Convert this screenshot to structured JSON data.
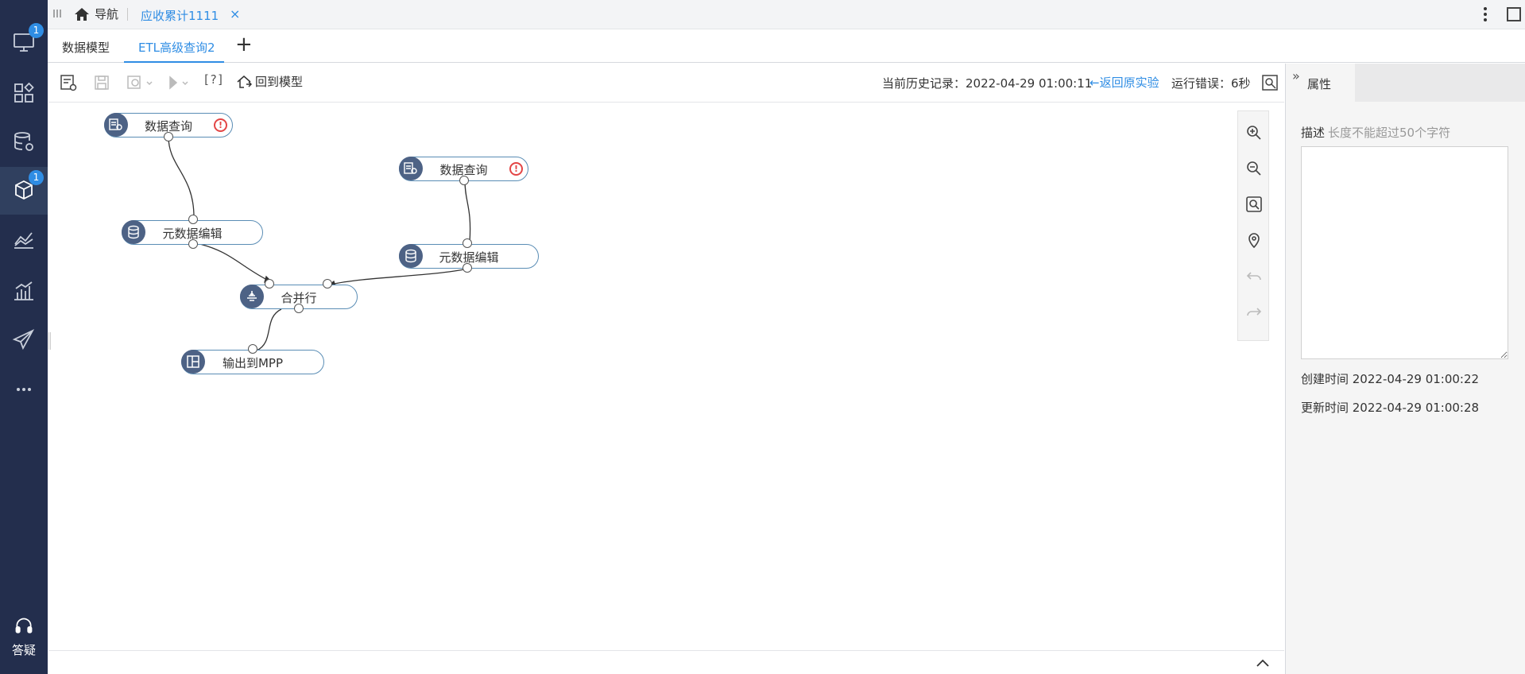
{
  "sidebar": {
    "items": [
      {
        "name": "monitor",
        "badge": "1"
      },
      {
        "name": "apps"
      },
      {
        "name": "database-settings"
      },
      {
        "name": "model-cube",
        "badge": "1"
      },
      {
        "name": "chart-line"
      },
      {
        "name": "chart-bar"
      },
      {
        "name": "send"
      },
      {
        "name": "more"
      }
    ],
    "help_label": "答疑"
  },
  "topbar": {
    "home_label": "导航",
    "doc_tab": "应收累计1111",
    "close_glyph": "×"
  },
  "subtabs": {
    "items": [
      "数据模型",
      "ETL高级查询2"
    ],
    "active": "ETL高级查询2",
    "add_glyph": "+"
  },
  "toolbar": {
    "help_label": "[?]",
    "back_label": "回到模型",
    "history_label": "当前历史记录：2022-04-29 01:00:11",
    "restore_label": "←返回原实验",
    "error_label": "运行错误：6秒"
  },
  "flow": {
    "nodes": [
      {
        "id": "q1",
        "label": "数据查询",
        "warning": true
      },
      {
        "id": "q2",
        "label": "数据查询",
        "warning": true
      },
      {
        "id": "m1",
        "label": "元数据编辑",
        "warning": false
      },
      {
        "id": "m2",
        "label": "元数据编辑",
        "warning": false
      },
      {
        "id": "merge",
        "label": "合并行",
        "warning": false
      },
      {
        "id": "out",
        "label": "输出到MPP",
        "warning": false
      }
    ],
    "warning_glyph": "!"
  },
  "panel": {
    "tab_label": "属性",
    "collapse_glyph": "»",
    "desc_label": "描述",
    "desc_hint": "长度不能超过50个字符",
    "desc_value": "",
    "created": "创建时间 2022-04-29 01:00:22",
    "updated": "更新时间 2022-04-29 01:00:28"
  },
  "colors": {
    "sidebar": "#232e4d",
    "accent": "#2f8de4",
    "node_border": "#5a8db5",
    "node_icon": "#4d6285",
    "warning": "#e34545"
  }
}
